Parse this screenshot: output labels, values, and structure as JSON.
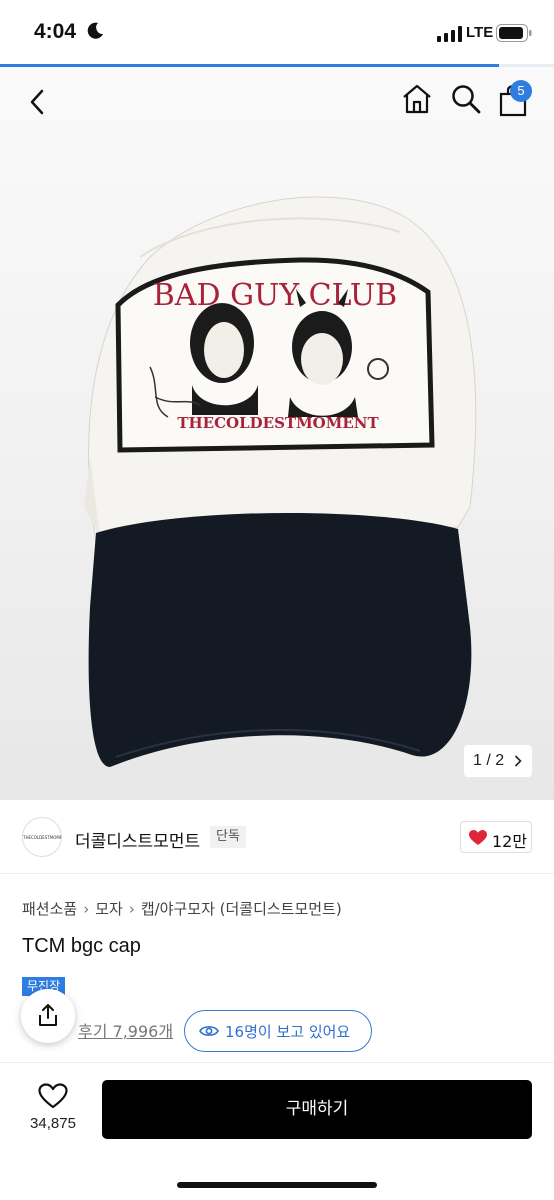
{
  "status_bar": {
    "time": "4:04",
    "network": "LTE"
  },
  "page_progress": 0.9,
  "nav": {
    "back_icon": "chevron-left-icon",
    "home_icon": "home-icon",
    "search_icon": "search-icon",
    "cart_icon": "shopping-bag-icon",
    "cart_count": "5"
  },
  "product_image": {
    "patch_headline": "BAD GUY CLUB",
    "patch_footer": "THECOLDESTMOMENT",
    "counter": "1 / 2"
  },
  "brand": {
    "logo_text": "THECOLDESTMOMENT",
    "name": "더콜디스트모먼트",
    "tag": "단독",
    "likes": "12만"
  },
  "breadcrumb": [
    "패션소품",
    "모자",
    "캡/야구모자 (더콜디스트모먼트)"
  ],
  "product": {
    "title": "TCM bgc cap",
    "badge": "무진장",
    "reviews": "후기 7,996개",
    "viewers": "16명이 보고 있어요"
  },
  "bottom_bar": {
    "wish_count": "34,875",
    "buy_label": "구매하기"
  },
  "colors": {
    "accent": "#2f7de1",
    "buy_button": "#000000",
    "heart": "#e0263a",
    "cap_navy": "#141a24",
    "patch_red": "#a8233a"
  }
}
